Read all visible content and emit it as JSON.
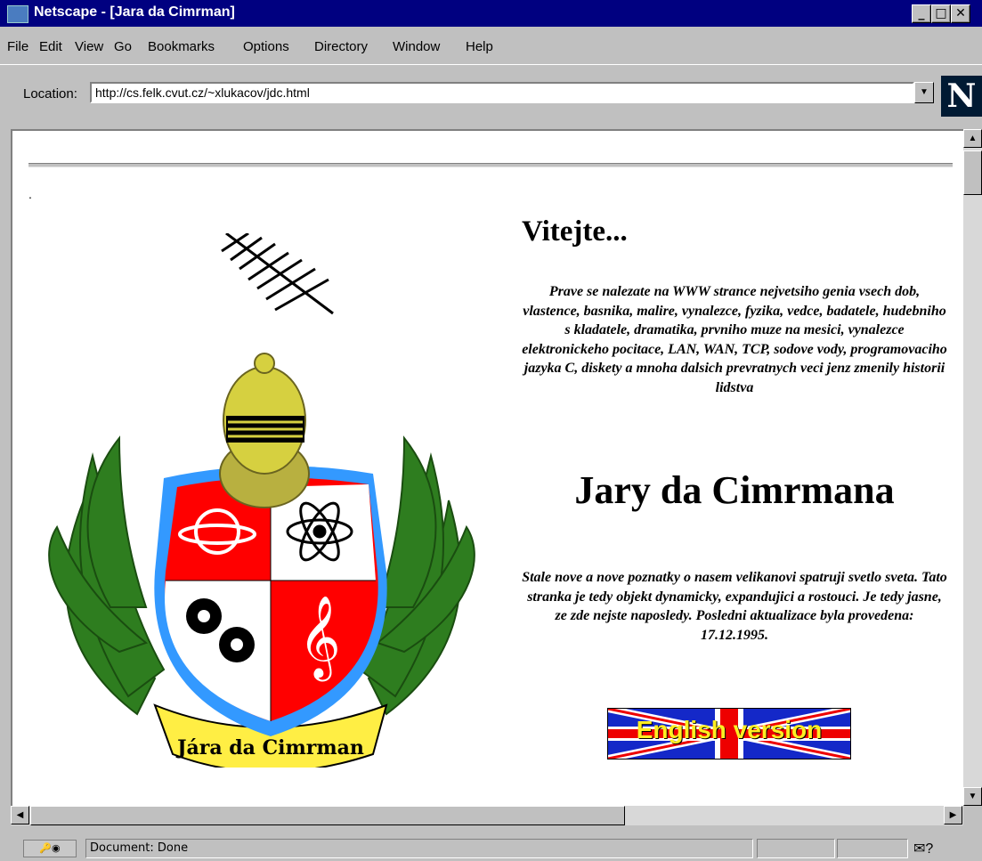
{
  "window": {
    "title": "Netscape - [Jara da Cimrman]"
  },
  "menu": [
    "File",
    "Edit",
    "View",
    "Go",
    "Bookmarks",
    "Options",
    "Directory",
    "Window",
    "Help"
  ],
  "location": {
    "label": "Location:",
    "url": "http://cs.felk.cvut.cz/~xlukacov/jdc.html"
  },
  "logo": {
    "letter": "N"
  },
  "page": {
    "dot": ".",
    "heading": "Vitejte...",
    "intro": "Prave se nalezate na WWW strance nejvetsiho genia vsech dob, vlastence, basnika, malire, vynalezce, fyzika, vedce, badatele, hudebniho s kladatele, dramatika, prvniho muze na mesici, vynalezce elektronickeho pocitace, LAN, WAN, TCP, sodove vody, programovaciho jazyka C, diskety a mnoha dalsich prevratnych veci jenz zmenily historii lidstva",
    "name": "Jary da Cimrmana",
    "update": "Stale nove a nove poznatky o nasem velikanovi spatruji svetlo sveta. Tato stranka je tedy objekt dynamicky, expandujici a rostouci. Je tedy jasne, ze zde nejste naposledy. Posledni aktualizace byla provedena: 17.12.1995.",
    "english_button": "English version",
    "banner_text": "Jára da Cimrman"
  },
  "status": {
    "text": "Document: Done"
  },
  "colors": {
    "titlebar": "#000080",
    "shield_red": "#ff0000",
    "shield_border": "#3399ff",
    "banner": "#ffee44",
    "leaves": "#2e7d1f"
  }
}
